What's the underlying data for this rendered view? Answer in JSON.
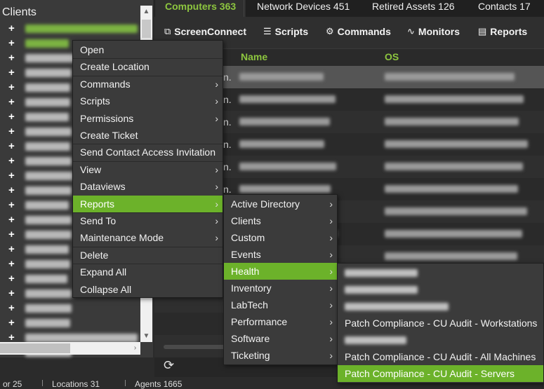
{
  "tree": {
    "title": "Clients",
    "rows_count_visible": 23
  },
  "tabs": [
    {
      "label": "Computers 363"
    },
    {
      "label": "Network Devices 451"
    },
    {
      "label": "Retired Assets 126"
    },
    {
      "label": "Contacts 17"
    }
  ],
  "toolbar": [
    {
      "label": "ScreenConnect",
      "icon": "screenconnect-icon"
    },
    {
      "label": "Scripts",
      "icon": "scripts-icon"
    },
    {
      "label": "Commands",
      "icon": "commands-icon"
    },
    {
      "label": "Monitors",
      "icon": "monitors-icon"
    },
    {
      "label": "Reports",
      "icon": "reports-icon"
    }
  ],
  "grid": {
    "columns": [
      "Name",
      "OS"
    ],
    "partial_cells": [
      "n.",
      "n.",
      "n.",
      "n.",
      "n.",
      "n."
    ]
  },
  "context_menu": {
    "items": [
      {
        "label": "Open",
        "submenu": false
      },
      {
        "label": "Create Location",
        "submenu": false
      },
      {
        "label": "Commands",
        "submenu": true
      },
      {
        "label": "Scripts",
        "submenu": true
      },
      {
        "label": "Permissions",
        "submenu": true
      },
      {
        "label": "Create Ticket",
        "submenu": false
      },
      {
        "label": "Send Contact Access Invitation",
        "submenu": false
      },
      {
        "label": "View",
        "submenu": true
      },
      {
        "label": "Dataviews",
        "submenu": true
      },
      {
        "label": "Reports",
        "submenu": true,
        "highlighted": true
      },
      {
        "label": "Send To",
        "submenu": true
      },
      {
        "label": "Maintenance Mode",
        "submenu": true
      },
      {
        "label": "Delete",
        "submenu": false
      },
      {
        "label": "Expand All",
        "submenu": false
      },
      {
        "label": "Collapse All",
        "submenu": false
      }
    ]
  },
  "reports_menu": {
    "items": [
      {
        "label": "Active Directory"
      },
      {
        "label": "Clients"
      },
      {
        "label": "Custom"
      },
      {
        "label": "Events"
      },
      {
        "label": "Health",
        "highlighted": true
      },
      {
        "label": "Inventory"
      },
      {
        "label": "LabTech"
      },
      {
        "label": "Performance"
      },
      {
        "label": "Software"
      },
      {
        "label": "Ticketing"
      }
    ]
  },
  "health_menu": {
    "items": [
      {
        "label": "",
        "blurred": true
      },
      {
        "label": "",
        "blurred": true
      },
      {
        "label": "",
        "blurred": true
      },
      {
        "label": "Patch Compliance - CU Audit - Workstations"
      },
      {
        "label": "",
        "blurred": true
      },
      {
        "label": "Patch Compliance - CU Audit - All Machines"
      },
      {
        "label": "Patch Compliance - CU Audit - Servers",
        "highlighted": true
      }
    ]
  },
  "status": {
    "left": "or 25",
    "mid": "Locations 31",
    "right": "Agents 1665"
  },
  "colors": {
    "accent": "#6cb22a",
    "header_green": "#8dc63f",
    "menu_bg": "#3b3b3b",
    "panel_bg": "#2f2f2f"
  }
}
